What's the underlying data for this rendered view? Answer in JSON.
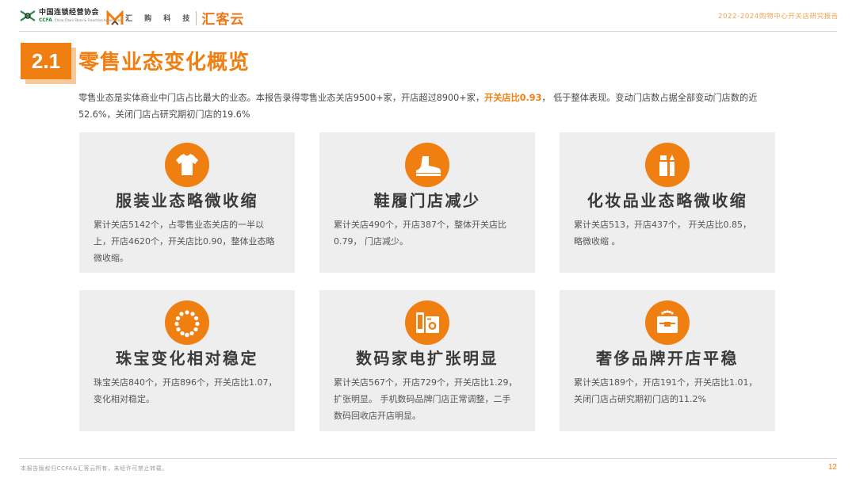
{
  "header": {
    "cgcfa_name": "中国连锁经营协会",
    "cgcfa_abbr": "CCFA",
    "cgcfa_en": "China Chain Store & Franchise Association",
    "huigou_name": "汇 购 科 技",
    "huike_name": "汇客云",
    "report_title": "2022-2024购物中心开关店研究报告"
  },
  "section": {
    "number": "2.1",
    "title": "零售业态变化概览",
    "intro_before": "零售业态是实体商业中门店占比最大的业态。本报告录得零售业态关店9500+家，开店超过8900+家，",
    "intro_highlight": "开关店比0.93",
    "intro_after": "， 低于整体表现。变动门店数占据全部变动门店数的近52.6%，关闭门店占研究期初门店的19.6%"
  },
  "cards": [
    {
      "icon": "tshirt-icon",
      "title": "服装业态略微收缩",
      "desc": "累计关店5142个，占零售业态关店的一半以上，开店4620个，开关店比0.90，整体业态略微收缩。"
    },
    {
      "icon": "shoe-icon",
      "title": "鞋履门店减少",
      "desc": "累计关店490个，开店387个，整体开关店比0.79， 门店减少。"
    },
    {
      "icon": "cosmetics-icon",
      "title": "化妆品业态略微收缩",
      "desc": "累计关店513，开店437个， 开关店比0.85，略微收缩 。"
    },
    {
      "icon": "necklace-icon",
      "title": "珠宝变化相对稳定",
      "desc": "珠宝关店840个，开店896个，开关店比1.07，变化相对稳定。"
    },
    {
      "icon": "appliance-icon",
      "title": "数码家电扩张明显",
      "desc": "累计关店567个，开店729个，开关店比1.29，扩张明显。 手机数码品牌门店正常调整，二手数码回收店开店明显。"
    },
    {
      "icon": "luxury-bag-icon",
      "title": "奢侈品牌开店平稳",
      "desc": "累计关店189个，开店191个，开关店比1.01，关闭门店占研究期初门店的11.2%"
    }
  ],
  "footer": {
    "note": "本报告版权归CCFA&汇客云所有，未经许可禁止转载。",
    "page": "12"
  },
  "colors": {
    "accent": "#f07f12",
    "card_bg": "#eeeeee"
  }
}
